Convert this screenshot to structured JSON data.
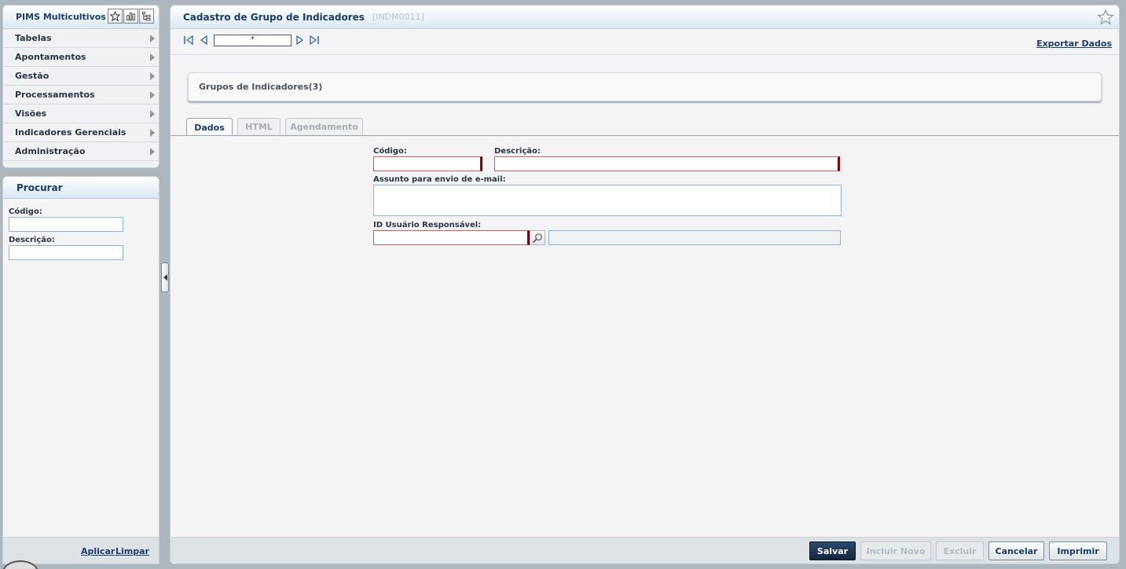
{
  "app": {
    "title": "PIMS Multicultivos",
    "header_icons": [
      "star-icon",
      "bar-chart-icon",
      "tree-list-icon"
    ]
  },
  "menu": {
    "items": [
      {
        "label": "Tabelas"
      },
      {
        "label": "Apontamentos"
      },
      {
        "label": "Gestão"
      },
      {
        "label": "Processamentos"
      },
      {
        "label": "Visões"
      },
      {
        "label": "Indicadores Gerenciais"
      },
      {
        "label": "Administração"
      }
    ]
  },
  "search": {
    "title": "Procurar",
    "codigo_label": "Código:",
    "codigo_value": "",
    "descricao_label": "Descrição:",
    "descricao_value": "",
    "apply_label": "Aplicar",
    "clear_label": "Limpar"
  },
  "page": {
    "title": "Cadastro de Grupo de Indicadores",
    "code": "[INDM0011]",
    "record_value": "*",
    "export_label": "Exportar Dados",
    "group_label": "Grupos de Indicadores(3)"
  },
  "tabs": [
    {
      "label": "Dados",
      "active": true
    },
    {
      "label": "HTML",
      "active": false
    },
    {
      "label": "Agendamento",
      "active": false
    }
  ],
  "form": {
    "codigo_label": "Código:",
    "codigo_value": "",
    "descricao_label": "Descrição:",
    "descricao_value": "",
    "assunto_label": "Assunto para envio de e-mail:",
    "assunto_value": "",
    "usuario_label": "ID Usuário Responsável:",
    "usuario_value": "",
    "usuario_name_value": ""
  },
  "footer": {
    "save_label": "Salvar",
    "new_label": "Incluir Novo",
    "delete_label": "Excluir",
    "cancel_label": "Cancelar",
    "print_label": "Imprimir"
  },
  "colors": {
    "brand_dark": "#1d3c66",
    "required_border": "#8b0000",
    "primary_button": "#1e3350"
  }
}
